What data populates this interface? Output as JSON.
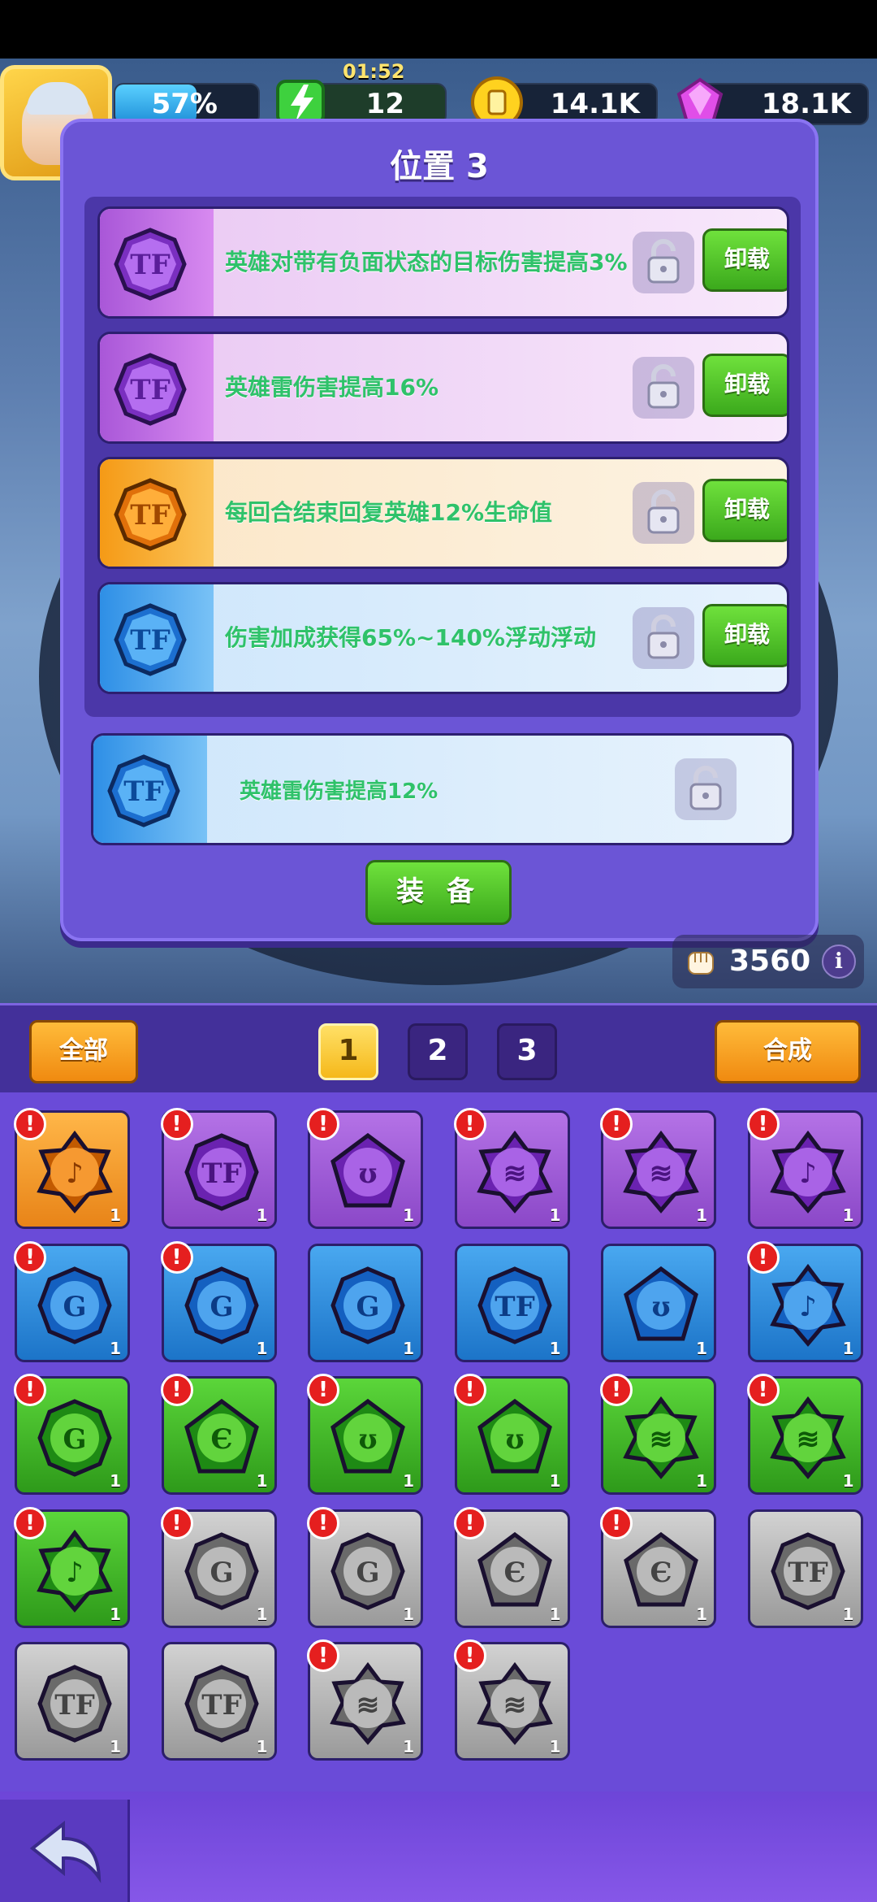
{
  "topbar": {
    "energy_percent": "57%",
    "energy_fraction": 0.57,
    "stamina_timer": "01:52",
    "stamina": "12",
    "gold": "14.1K",
    "gems": "18.1K"
  },
  "panel": {
    "title": "位置 3",
    "slots": [
      {
        "rarity": "purple",
        "rune": "rune-tf",
        "text": "英雄对带有负面状态的目标伤害提高3%",
        "button": "卸载"
      },
      {
        "rarity": "purple",
        "rune": "rune-tf",
        "text": "英雄雷伤害提高16%",
        "button": "卸载"
      },
      {
        "rarity": "orange",
        "rune": "rune-tf",
        "text": "每回合结束回复英雄12%生命值",
        "button": "卸载"
      },
      {
        "rarity": "blue",
        "rune": "rune-tf",
        "text": "伤害加成获得65%~140%浮动浮动",
        "button": "卸载"
      }
    ],
    "new_slot": {
      "rarity": "blue",
      "rune": "rune-tf",
      "text": "英雄雷伤害提高12%"
    },
    "equip_button": "装 备"
  },
  "power": {
    "value": "3560",
    "info": "i"
  },
  "inventory": {
    "all_button": "全部",
    "merge_button": "合成",
    "pages": [
      "1",
      "2",
      "3"
    ],
    "active_page": "1",
    "items": [
      {
        "color": "orange",
        "rune": "rune-swirl-star",
        "count": "1",
        "alert": true
      },
      {
        "color": "purple",
        "rune": "rune-tf",
        "count": "1",
        "alert": true
      },
      {
        "color": "purple",
        "rune": "rune-ram",
        "count": "1",
        "alert": true
      },
      {
        "color": "purple",
        "rune": "rune-wave-star",
        "count": "1",
        "alert": true
      },
      {
        "color": "purple",
        "rune": "rune-wave-star",
        "count": "1",
        "alert": true
      },
      {
        "color": "purple",
        "rune": "rune-swirl-star",
        "count": "1",
        "alert": true
      },
      {
        "color": "blue",
        "rune": "rune-g",
        "count": "1",
        "alert": true
      },
      {
        "color": "blue",
        "rune": "rune-g",
        "count": "1",
        "alert": true
      },
      {
        "color": "blue",
        "rune": "rune-g",
        "count": "1",
        "alert": false
      },
      {
        "color": "blue",
        "rune": "rune-tf",
        "count": "1",
        "alert": false
      },
      {
        "color": "blue",
        "rune": "rune-ram",
        "count": "1",
        "alert": false
      },
      {
        "color": "blue",
        "rune": "rune-swirl-star",
        "count": "1",
        "alert": true
      },
      {
        "color": "green",
        "rune": "rune-g",
        "count": "1",
        "alert": true
      },
      {
        "color": "green",
        "rune": "rune-e",
        "count": "1",
        "alert": true
      },
      {
        "color": "green",
        "rune": "rune-ram",
        "count": "1",
        "alert": true
      },
      {
        "color": "green",
        "rune": "rune-ram",
        "count": "1",
        "alert": true
      },
      {
        "color": "green",
        "rune": "rune-wave-star",
        "count": "1",
        "alert": true
      },
      {
        "color": "green",
        "rune": "rune-wave-star",
        "count": "1",
        "alert": true
      },
      {
        "color": "green",
        "rune": "rune-swirl-star",
        "count": "1",
        "alert": true
      },
      {
        "color": "gray",
        "rune": "rune-g",
        "count": "1",
        "alert": true
      },
      {
        "color": "gray",
        "rune": "rune-g",
        "count": "1",
        "alert": true
      },
      {
        "color": "gray",
        "rune": "rune-e",
        "count": "1",
        "alert": true
      },
      {
        "color": "gray",
        "rune": "rune-e",
        "count": "1",
        "alert": true
      },
      {
        "color": "gray",
        "rune": "rune-tf",
        "count": "1",
        "alert": false
      },
      {
        "color": "gray",
        "rune": "rune-tf",
        "count": "1",
        "alert": false
      },
      {
        "color": "gray",
        "rune": "rune-tf",
        "count": "1",
        "alert": false
      },
      {
        "color": "gray",
        "rune": "rune-wave-star",
        "count": "1",
        "alert": true
      },
      {
        "color": "gray",
        "rune": "rune-wave-star",
        "count": "1",
        "alert": true
      }
    ]
  },
  "colors": {
    "panel": "#6b55d6",
    "text_green": "#2fc26a",
    "button_green": "#3ba91c",
    "button_orange": "#f08a10",
    "alert_red": "#e51f1f"
  }
}
